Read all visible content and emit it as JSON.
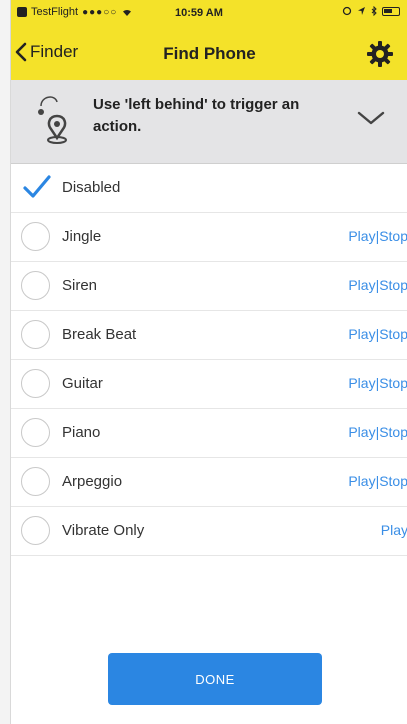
{
  "status_bar": {
    "carrier": "TestFlight",
    "signal": "●●●○○",
    "time": "10:59 AM"
  },
  "nav": {
    "back_label": "Finder",
    "title": "Find Phone"
  },
  "banner": {
    "text": "Use 'left behind' to trigger an action."
  },
  "sounds": [
    {
      "label": "Disabled",
      "selected": true,
      "action": ""
    },
    {
      "label": "Jingle",
      "selected": false,
      "action": "Play|Stop"
    },
    {
      "label": "Siren",
      "selected": false,
      "action": "Play|Stop"
    },
    {
      "label": "Break Beat",
      "selected": false,
      "action": "Play|Stop"
    },
    {
      "label": "Guitar",
      "selected": false,
      "action": "Play|Stop"
    },
    {
      "label": "Piano",
      "selected": false,
      "action": "Play|Stop"
    },
    {
      "label": "Arpeggio",
      "selected": false,
      "action": "Play|Stop"
    },
    {
      "label": "Vibrate Only",
      "selected": false,
      "action": "Play"
    }
  ],
  "done_label": "DONE",
  "colors": {
    "header": "#f4e229",
    "accent": "#2b86e2",
    "link": "#3a8ee6"
  },
  "icons": {
    "back": "chevron-left-icon",
    "settings": "gear-icon",
    "banner": "location-pin-icon",
    "expand": "chevron-down-icon",
    "selected": "checkmark-icon"
  }
}
